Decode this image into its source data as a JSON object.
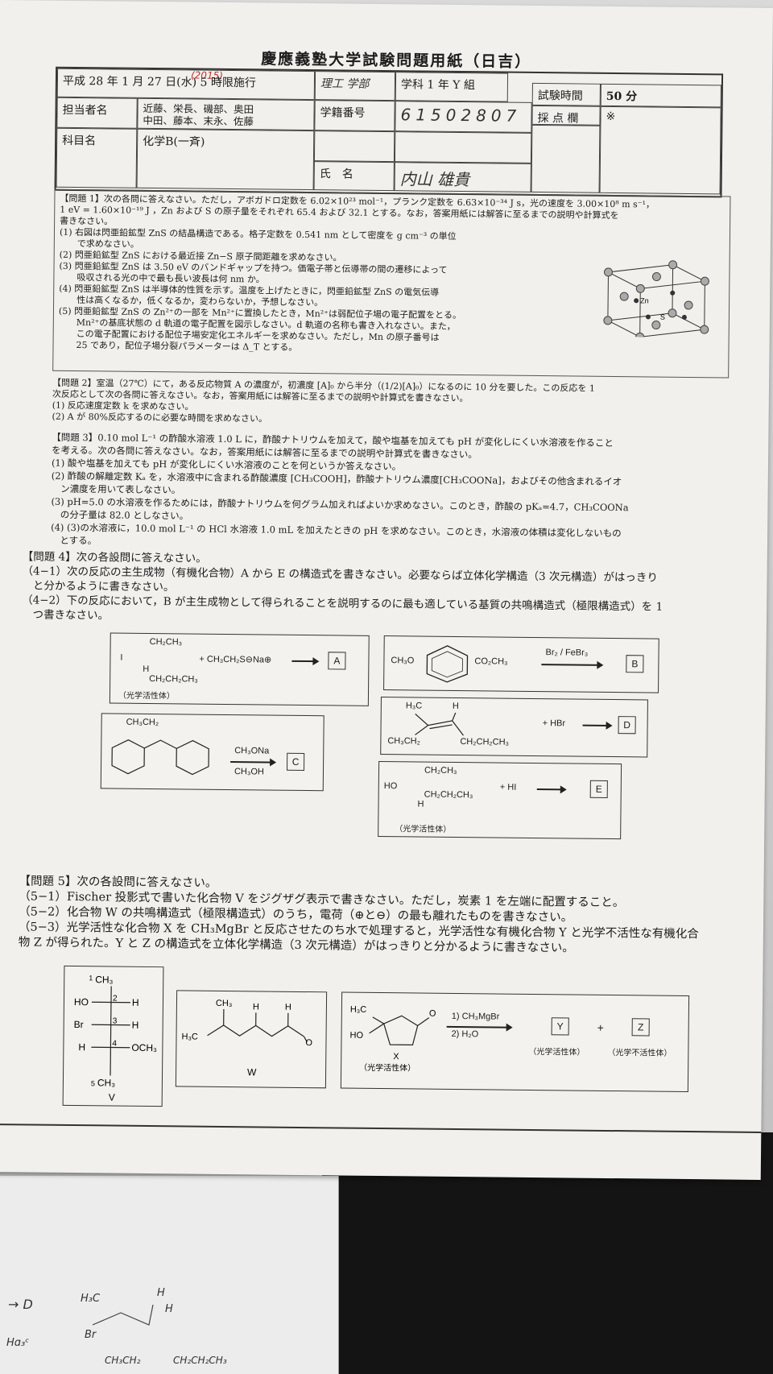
{
  "header": {
    "handwritten_year": "(2015)",
    "title": "慶應義塾大学試験問題用紙（日吉）",
    "date_line": "平成 28 年 1 月 27 日(水) 5 時限施行",
    "faculty": "理工 学部",
    "dept": "学科 1 年 Y 組",
    "exam_time_label": "試験時間",
    "exam_time_value": "50 分",
    "score_unit": "分",
    "scoring_label": "採 点 欄",
    "scoring_mark": "※",
    "teacher_label": "担当者名",
    "teachers_line1": "近藤、栄長、磯部、奥田",
    "teachers_line2": "中田、藤本、末永、佐藤",
    "student_no_label": "学籍番号",
    "student_no": "61502807",
    "subject_label": "科目名",
    "subject": "化学B(一斉)",
    "name_label": "氏　名",
    "name_value": "内山 雄貴"
  },
  "q1": {
    "lines": [
      "【問題 1】次の各問に答えなさい。ただし，アボガドロ定数を 6.02×10²³ mol⁻¹，プランク定数を 6.63×10⁻³⁴ J s，光の速度を 3.00×10⁸ m s⁻¹，",
      "1 eV = 1.60×10⁻¹⁹ J ，Zn および S の原子量をそれぞれ 65.4 および 32.1 とする。なお，答案用紙には解答に至るまでの説明や計算式を",
      "書きなさい。",
      "(1) 右図は閃亜鉛鉱型 ZnS の結晶構造である。格子定数を 0.541 nm として密度を g cm⁻³ の単位",
      "　　で求めなさい。",
      "(2) 閃亜鉛鉱型 ZnS における最近接 Zn−S 原子間距離を求めなさい。",
      "(3) 閃亜鉛鉱型 ZnS は 3.50 eV のバンドギャップを持つ。価電子帯と伝導帯の間の遷移によって",
      "　　吸収される光の中で最も長い波長は何 nm か。",
      "(4) 閃亜鉛鉱型 ZnS は半導体的性質を示す。温度を上げたときに，閃亜鉛鉱型 ZnS の電気伝導",
      "　　性は高くなるか，低くなるか，変わらないか，予想しなさい。",
      "(5) 閃亜鉛鉱型 ZnS の Zn²⁺の一部を Mn²⁺に置換したとき，Mn²⁺は弱配位子場の電子配置をとる。",
      "　　Mn²⁺の基底状態の d 軌道の電子配置を図示しなさい。d 軌道の名称も書き入れなさい。また，",
      "　　この電子配置における配位子場安定化エネルギーを求めなさい。ただし，Mn の原子番号は",
      "　　25 であり，配位子場分裂パラメーターは Δ_T とする。"
    ],
    "crystal_labels": [
      "Zn",
      "S"
    ]
  },
  "q2": {
    "lines": [
      "【問題 2】室温（27℃）にて，ある反応物質 A の濃度が，初濃度 [A]₀ から半分（(1/2)[A]₀）になるのに 10 分を要した。この反応を 1",
      "次反応として次の各問に答えなさい。なお，答案用紙には解答に至るまでの説明や計算式を書きなさい。",
      "(1) 反応速度定数 k を求めなさい。",
      "(2) A が 80%反応するのに必要な時間を求めなさい。"
    ]
  },
  "q3": {
    "lines": [
      "【問題 3】0.10 mol L⁻¹ の酢酸水溶液 1.0 L に，酢酸ナトリウムを加えて，酸や塩基を加えても pH が変化しにくい水溶液を作ること",
      "を考える。次の各問に答えなさい。なお，答案用紙には解答に至るまでの説明や計算式を書きなさい。",
      "(1) 酸や塩基を加えても pH が変化しにくい水溶液のことを何というか答えなさい。",
      "(2) 酢酸の解離定数 Kₐ を，水溶液中に含まれる酢酸濃度 [CH₃COOH]，酢酸ナトリウム濃度[CH₃COONa]，およびその他含まれるイオ",
      "　ン濃度を用いて表しなさい。",
      "(3) pH=5.0 の水溶液を作るためには，酢酸ナトリウムを何グラム加えればよいか求めなさい。このとき，酢酸の pKₐ=4.7，CH₃COONa",
      "　の分子量は 82.0 としなさい。",
      "(4) (3)の水溶液に，10.0 mol L⁻¹ の HCl 水溶液 1.0 mL を加えたときの pH を求めなさい。このとき，水溶液の体積は変化しないもの",
      "　とする。"
    ]
  },
  "q4": {
    "lines": [
      "【問題 4】次の各設問に答えなさい。",
      "（4−1）次の反応の主生成物（有機化合物）A から E の構造式を書きなさい。必要ならば立体化学構造（3 次元構造）がはっきり",
      "　と分かるように書きなさい。",
      "（4−2）下の反応において，B が主生成物として得られることを説明するのに最も適している基質の共鳴構造式（極限構造式）を 1",
      "　つ書きなさい。"
    ],
    "rxA": {
      "top": "CH₂CH₃",
      "left": "I",
      "bottom1": "H",
      "bottom2": "CH₂CH₂CH₃",
      "reagent": "+ CH₃CH₂S⊖Na⊕",
      "product": "A",
      "note": "（光学活性体）"
    },
    "rxB": {
      "left": "CH₃O",
      "right": "CO₂CH₃",
      "reagent": "Br₂ / FeBr₃",
      "product": "B"
    },
    "rxC": {
      "top": "CH₃CH₂",
      "reagent1": "CH₃ONa",
      "reagent2": "CH₃OH",
      "product": "C"
    },
    "rxD": {
      "tl": "H₃C",
      "tr": "H",
      "bl": "CH₃CH₂",
      "br": "CH₂CH₂CH₃",
      "reagent": "+ HBr",
      "product": "D"
    },
    "rxE": {
      "top": "CH₂CH₃",
      "left": "HO",
      "bottom1": "H",
      "bottom2": "CH₂CH₂CH₃",
      "reagent": "+ HI",
      "product": "E",
      "note": "（光学活性体）"
    }
  },
  "q5": {
    "lines": [
      "【問題 5】次の各設問に答えなさい。",
      "（5−1）Fischer 投影式で書いた化合物 V をジグザグ表示で書きなさい。ただし，炭素 1 を左端に配置すること。",
      "（5−2）化合物 W の共鳴構造式（極限構造式）のうち，電荷（⊕と⊖）の最も離れたものを書きなさい。",
      "（5−3）光学活性な化合物 X を CH₃MgBr と反応させたのち水で処理すると，光学活性な有機化合物 Y と光学不活性な有機化合",
      "物 Z が得られた。Y と Z の構造式を立体化学構造（3 次元構造）がはっきりと分かるように書きなさい。"
    ],
    "V": {
      "c1": "CH₃",
      "r2": [
        "HO",
        "2",
        "H"
      ],
      "r3": [
        "Br",
        "3",
        "H"
      ],
      "r4": [
        "H",
        "4",
        "OCH₃"
      ],
      "c5": "CH₃",
      "n1": "1",
      "n5": "5",
      "label": "V"
    },
    "W": {
      "ch3": "CH₃",
      "h1": "H",
      "h2": "H",
      "left": "H₃C",
      "o": "O",
      "label": "W"
    },
    "X": {
      "me": "H₃C",
      "ho": "HO",
      "o": "O",
      "label": "X",
      "note": "（光学活性体）",
      "step1": "1) CH₃MgBr",
      "step2": "2) H₂O",
      "y": "Y",
      "plus": "+",
      "z": "Z",
      "y_note": "（光学活性体）",
      "z_note": "（光学不活性体）"
    }
  },
  "handwritten_notes": {
    "d_box": "→ D",
    "h3c": "H₃C",
    "h1": "H",
    "h2": "H",
    "br": "Br",
    "et": "CH₃CH₂",
    "pr": "CH₂CH₂CH₃",
    "side": "Hɑ₃ᶜ"
  }
}
